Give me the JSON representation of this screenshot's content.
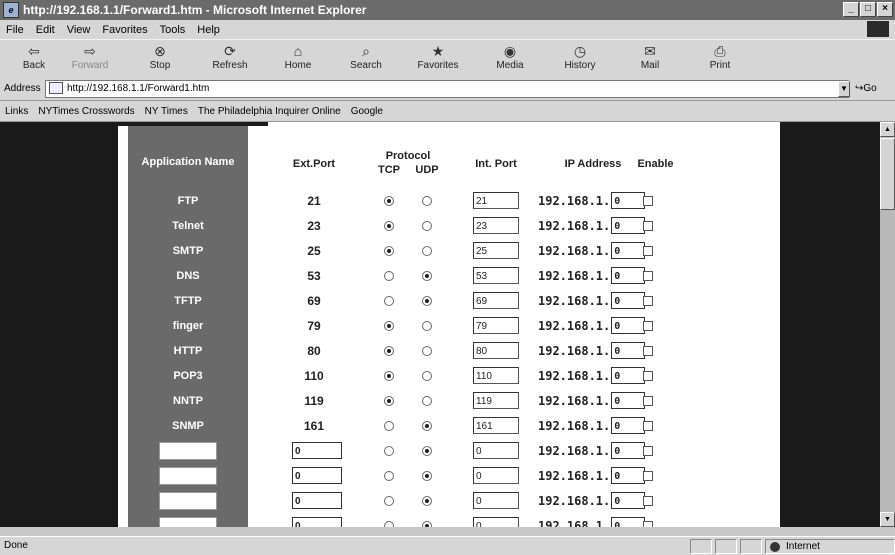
{
  "window": {
    "title": "http://192.168.1.1/Forward1.htm - Microsoft Internet Explorer"
  },
  "menu": [
    "File",
    "Edit",
    "View",
    "Favorites",
    "Tools",
    "Help"
  ],
  "toolbar": {
    "back": "Back",
    "forward": "Forward",
    "stop": "Stop",
    "refresh": "Refresh",
    "home": "Home",
    "search": "Search",
    "favorites": "Favorites",
    "media": "Media",
    "history": "History",
    "mail": "Mail",
    "print": "Print"
  },
  "address": {
    "label": "Address",
    "url": "http://192.168.1.1/Forward1.htm",
    "go": "Go"
  },
  "links": {
    "label": "Links",
    "items": [
      "NYTimes Crosswords",
      "NY Times",
      "The Philadelphia Inquirer Online",
      "Google"
    ]
  },
  "table": {
    "headers": {
      "app": "Application Name",
      "ext": "Ext.Port",
      "protocol": "Protocol",
      "tcp": "TCP",
      "udp": "UDP",
      "int": "Int. Port",
      "ip": "IP Address",
      "enable": "Enable"
    },
    "ip_prefix": "192.168.1.",
    "rows": [
      {
        "name": "FTP",
        "ext": "21",
        "protocol": "TCP",
        "int": "21",
        "ip_last": "0"
      },
      {
        "name": "Telnet",
        "ext": "23",
        "protocol": "TCP",
        "int": "23",
        "ip_last": "0"
      },
      {
        "name": "SMTP",
        "ext": "25",
        "protocol": "TCP",
        "int": "25",
        "ip_last": "0"
      },
      {
        "name": "DNS",
        "ext": "53",
        "protocol": "UDP",
        "int": "53",
        "ip_last": "0"
      },
      {
        "name": "TFTP",
        "ext": "69",
        "protocol": "UDP",
        "int": "69",
        "ip_last": "0"
      },
      {
        "name": "finger",
        "ext": "79",
        "protocol": "TCP",
        "int": "79",
        "ip_last": "0"
      },
      {
        "name": "HTTP",
        "ext": "80",
        "protocol": "TCP",
        "int": "80",
        "ip_last": "0"
      },
      {
        "name": "POP3",
        "ext": "110",
        "protocol": "TCP",
        "int": "110",
        "ip_last": "0"
      },
      {
        "name": "NNTP",
        "ext": "119",
        "protocol": "TCP",
        "int": "119",
        "ip_last": "0"
      },
      {
        "name": "SNMP",
        "ext": "161",
        "protocol": "UDP",
        "int": "161",
        "ip_last": "0"
      }
    ],
    "custom_rows": [
      {
        "ext": "0",
        "protocol": "UDP",
        "int": "0",
        "ip_last": "0"
      },
      {
        "ext": "0",
        "protocol": "UDP",
        "int": "0",
        "ip_last": "0"
      },
      {
        "ext": "0",
        "protocol": "UDP",
        "int": "0",
        "ip_last": "0"
      },
      {
        "ext": "0",
        "protocol": "UDP",
        "int": "0",
        "ip_last": "0"
      }
    ]
  },
  "status": {
    "text": "Done",
    "zone": "Internet"
  }
}
